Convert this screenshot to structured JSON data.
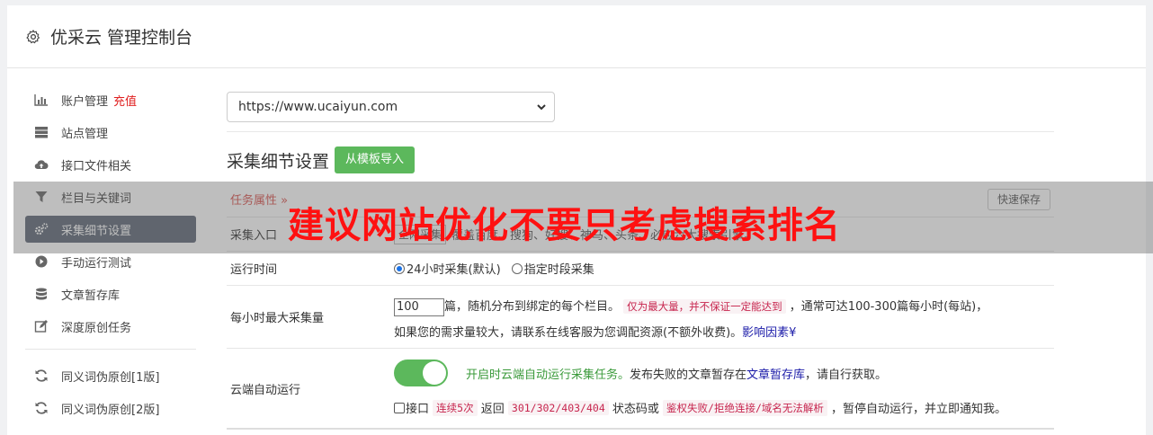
{
  "header": {
    "title": "优采云 管理控制台",
    "icon": "gear-icon"
  },
  "sidebar": {
    "items": [
      {
        "label": "账户管理",
        "badge": "充值",
        "icon": "bar-chart-icon"
      },
      {
        "label": "站点管理",
        "icon": "server-icon"
      },
      {
        "label": "接口文件相关",
        "icon": "cloud-upload-icon"
      },
      {
        "label": "栏目与关键词",
        "icon": "filter-icon"
      },
      {
        "label": "采集细节设置",
        "icon": "gears-icon",
        "active": true
      },
      {
        "label": "手动运行测试",
        "icon": "play-circle-icon"
      },
      {
        "label": "文章暂存库",
        "icon": "database-icon"
      },
      {
        "label": "深度原创任务",
        "icon": "edit-icon"
      },
      {
        "label": "同义词伪原创[1版]",
        "icon": "refresh-icon"
      },
      {
        "label": "同义词伪原创[2版]",
        "icon": "refresh-icon"
      }
    ]
  },
  "main": {
    "site_select": "https://www.ucaiyun.com",
    "section_title": "采集细节设置",
    "import_button": "从模板导入",
    "task_props": "任务属性",
    "quick_save": "快速保存",
    "entry": {
      "label": "采集入口",
      "select_value": "全网采集",
      "text": "覆盖百度、搜狗、好搜、神马、头条、必应六大搜索引擎。"
    },
    "runtime": {
      "label": "运行时间",
      "opt1": "24小时采集(默认)",
      "opt2": "指定时段采集"
    },
    "max_per_hour": {
      "label": "每小时最大采集量",
      "value": "100",
      "t1": "篇，随机分布到绑定的每个栏目。",
      "code1": "仅为最大量，并不保证一定能达到",
      "t2": "，通常可达100-300篇每小时(每站)，",
      "t3": "如果您的需求量较大，请联系在线客服为您调配资源(不额外收费)。",
      "link": "影响因素"
    },
    "cloud_run": {
      "label": "云端自动运行",
      "on_text": "开启时云端自动运行采集任务。",
      "t1": "发布失败的文章暂存在",
      "link": "文章暂存库",
      "t2": "，请自行获取。",
      "b_pre": "接口",
      "b_code1": "连续5次",
      "b_t1": "返回",
      "b_code2": "301/302/403/404",
      "b_t2": "状态码或",
      "b_code3": "鉴权失败/拒绝连接/域名无法解析",
      "b_t3": "，暂停自动运行，并立即通知我。"
    }
  },
  "overlay": {
    "text": "建议网站优化不要只考虑搜索排名"
  }
}
